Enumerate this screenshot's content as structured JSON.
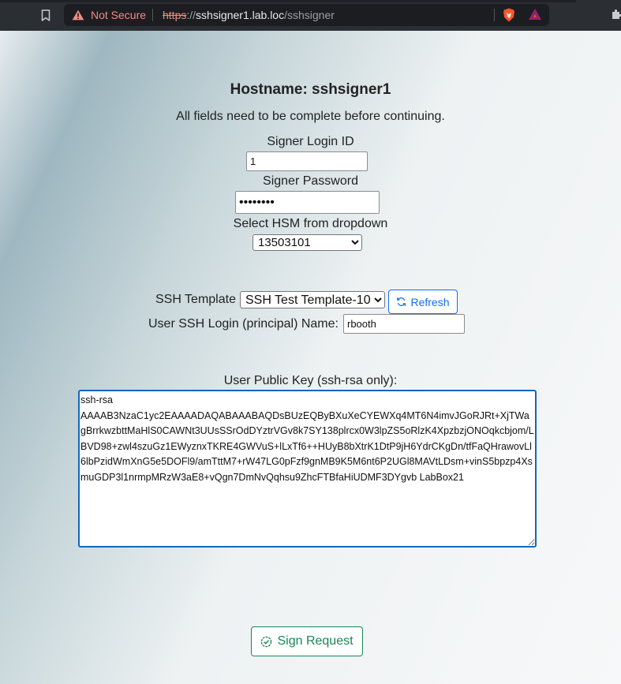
{
  "browser": {
    "security_label": "Not Secure",
    "url_scheme": "https",
    "url_sep": "://",
    "url_host": "sshsigner1.lab.loc",
    "url_path": "/sshsigner"
  },
  "page": {
    "hostname_heading": "Hostname: sshsigner1",
    "instruction": "All fields need to be complete before continuing.",
    "login_id_label": "Signer Login ID",
    "login_id_value": "1",
    "password_label": "Signer Password",
    "password_value": "password",
    "hsm_label": "Select HSM from dropdown",
    "hsm_selected": "13503101",
    "template_label": "SSH Template",
    "template_selected": "SSH Test Template-10",
    "refresh_label": "Refresh",
    "principal_label": "User SSH Login (principal) Name:",
    "principal_value": "rbooth",
    "pubkey_label": "User Public Key (ssh-rsa only):",
    "pubkey_value": "ssh-rsa\nAAAAB3NzaC1yc2EAAAADAQABAAABAQDsBUzEQByBXuXeCYEWXq4MT6N4imvJGoRJRt+XjTWagBrrkwzbttMaHlS0CAWNt3UUsSSrOdDYztrVGv8k7SY138plrcx0W3lpZS5oRlzK4XpzbzjONOqkcbjom/LBVD98+zwl4szuGz1EWyznxTKRE4GWVuS+lLxTf6++HUyB8bXtrK1DtP9jH6YdrCKgDn/tfFaQHrawovLl6lbPzidWmXnG5e5DOFl9/amTttM7+rW47LG0pFzf9gnMB9K5M6nt6P2UGl8MAVtLDsm+vinS5bpzp4XsmuGDP3l1nrmpMRzW3aE8+vQgn7DmNvQqhsu9ZhcFTBfaHiUDMF3DYgvb LabBox21",
    "sign_label": "Sign Request"
  },
  "colors": {
    "refresh_accent": "#0d6efd",
    "sign_accent": "#198754",
    "textarea_focus": "#1565c0",
    "not_secure": "#f28b82"
  },
  "icons": {
    "bookmark": "bookmark-icon",
    "warning": "warning-triangle-icon",
    "brave": "brave-shield-icon",
    "bat": "bat-rewards-icon",
    "extensions": "puzzle-icon",
    "refresh": "refresh-arrows-icon",
    "sign": "check-circle-icon"
  }
}
